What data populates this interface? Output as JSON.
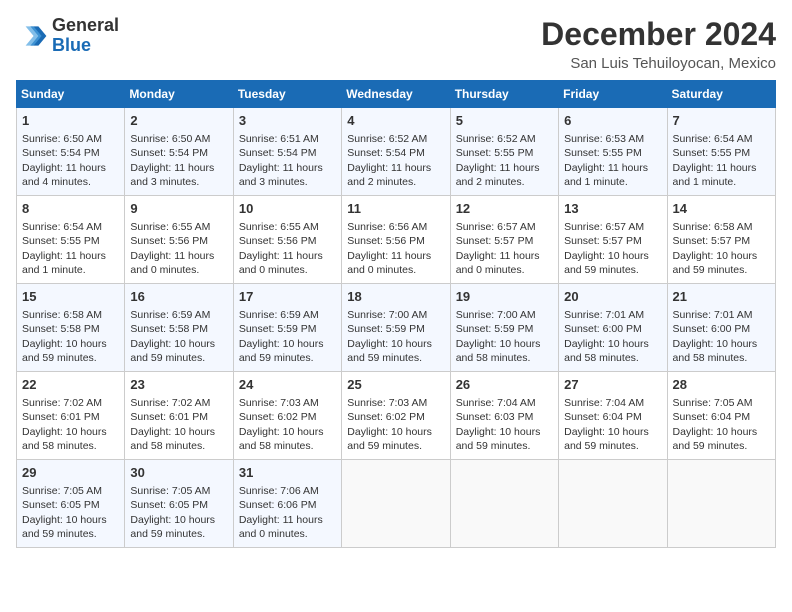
{
  "header": {
    "logo_line1": "General",
    "logo_line2": "Blue",
    "month": "December 2024",
    "location": "San Luis Tehuiloyocan, Mexico"
  },
  "days_of_week": [
    "Sunday",
    "Monday",
    "Tuesday",
    "Wednesday",
    "Thursday",
    "Friday",
    "Saturday"
  ],
  "weeks": [
    [
      {
        "day": "1",
        "info": "Sunrise: 6:50 AM\nSunset: 5:54 PM\nDaylight: 11 hours and 4 minutes."
      },
      {
        "day": "2",
        "info": "Sunrise: 6:50 AM\nSunset: 5:54 PM\nDaylight: 11 hours and 3 minutes."
      },
      {
        "day": "3",
        "info": "Sunrise: 6:51 AM\nSunset: 5:54 PM\nDaylight: 11 hours and 3 minutes."
      },
      {
        "day": "4",
        "info": "Sunrise: 6:52 AM\nSunset: 5:54 PM\nDaylight: 11 hours and 2 minutes."
      },
      {
        "day": "5",
        "info": "Sunrise: 6:52 AM\nSunset: 5:55 PM\nDaylight: 11 hours and 2 minutes."
      },
      {
        "day": "6",
        "info": "Sunrise: 6:53 AM\nSunset: 5:55 PM\nDaylight: 11 hours and 1 minute."
      },
      {
        "day": "7",
        "info": "Sunrise: 6:54 AM\nSunset: 5:55 PM\nDaylight: 11 hours and 1 minute."
      }
    ],
    [
      {
        "day": "8",
        "info": "Sunrise: 6:54 AM\nSunset: 5:55 PM\nDaylight: 11 hours and 1 minute."
      },
      {
        "day": "9",
        "info": "Sunrise: 6:55 AM\nSunset: 5:56 PM\nDaylight: 11 hours and 0 minutes."
      },
      {
        "day": "10",
        "info": "Sunrise: 6:55 AM\nSunset: 5:56 PM\nDaylight: 11 hours and 0 minutes."
      },
      {
        "day": "11",
        "info": "Sunrise: 6:56 AM\nSunset: 5:56 PM\nDaylight: 11 hours and 0 minutes."
      },
      {
        "day": "12",
        "info": "Sunrise: 6:57 AM\nSunset: 5:57 PM\nDaylight: 11 hours and 0 minutes."
      },
      {
        "day": "13",
        "info": "Sunrise: 6:57 AM\nSunset: 5:57 PM\nDaylight: 10 hours and 59 minutes."
      },
      {
        "day": "14",
        "info": "Sunrise: 6:58 AM\nSunset: 5:57 PM\nDaylight: 10 hours and 59 minutes."
      }
    ],
    [
      {
        "day": "15",
        "info": "Sunrise: 6:58 AM\nSunset: 5:58 PM\nDaylight: 10 hours and 59 minutes."
      },
      {
        "day": "16",
        "info": "Sunrise: 6:59 AM\nSunset: 5:58 PM\nDaylight: 10 hours and 59 minutes."
      },
      {
        "day": "17",
        "info": "Sunrise: 6:59 AM\nSunset: 5:59 PM\nDaylight: 10 hours and 59 minutes."
      },
      {
        "day": "18",
        "info": "Sunrise: 7:00 AM\nSunset: 5:59 PM\nDaylight: 10 hours and 59 minutes."
      },
      {
        "day": "19",
        "info": "Sunrise: 7:00 AM\nSunset: 5:59 PM\nDaylight: 10 hours and 58 minutes."
      },
      {
        "day": "20",
        "info": "Sunrise: 7:01 AM\nSunset: 6:00 PM\nDaylight: 10 hours and 58 minutes."
      },
      {
        "day": "21",
        "info": "Sunrise: 7:01 AM\nSunset: 6:00 PM\nDaylight: 10 hours and 58 minutes."
      }
    ],
    [
      {
        "day": "22",
        "info": "Sunrise: 7:02 AM\nSunset: 6:01 PM\nDaylight: 10 hours and 58 minutes."
      },
      {
        "day": "23",
        "info": "Sunrise: 7:02 AM\nSunset: 6:01 PM\nDaylight: 10 hours and 58 minutes."
      },
      {
        "day": "24",
        "info": "Sunrise: 7:03 AM\nSunset: 6:02 PM\nDaylight: 10 hours and 58 minutes."
      },
      {
        "day": "25",
        "info": "Sunrise: 7:03 AM\nSunset: 6:02 PM\nDaylight: 10 hours and 59 minutes."
      },
      {
        "day": "26",
        "info": "Sunrise: 7:04 AM\nSunset: 6:03 PM\nDaylight: 10 hours and 59 minutes."
      },
      {
        "day": "27",
        "info": "Sunrise: 7:04 AM\nSunset: 6:04 PM\nDaylight: 10 hours and 59 minutes."
      },
      {
        "day": "28",
        "info": "Sunrise: 7:05 AM\nSunset: 6:04 PM\nDaylight: 10 hours and 59 minutes."
      }
    ],
    [
      {
        "day": "29",
        "info": "Sunrise: 7:05 AM\nSunset: 6:05 PM\nDaylight: 10 hours and 59 minutes."
      },
      {
        "day": "30",
        "info": "Sunrise: 7:05 AM\nSunset: 6:05 PM\nDaylight: 10 hours and 59 minutes."
      },
      {
        "day": "31",
        "info": "Sunrise: 7:06 AM\nSunset: 6:06 PM\nDaylight: 11 hours and 0 minutes."
      },
      {
        "day": "",
        "info": ""
      },
      {
        "day": "",
        "info": ""
      },
      {
        "day": "",
        "info": ""
      },
      {
        "day": "",
        "info": ""
      }
    ]
  ]
}
